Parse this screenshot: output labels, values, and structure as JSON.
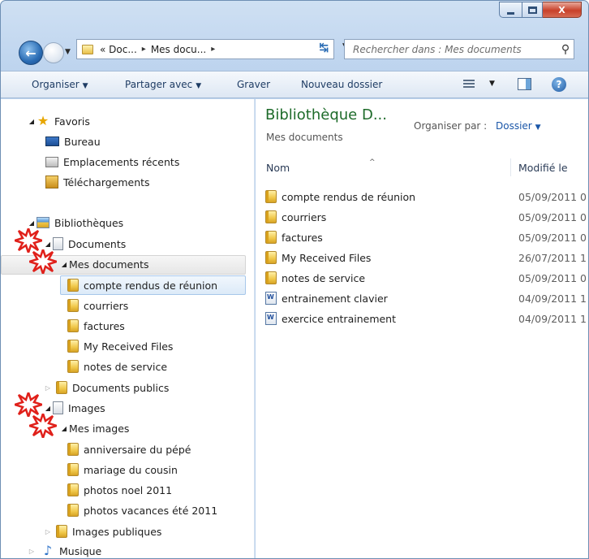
{
  "window": {
    "caption": {
      "minimize_icon": "minimize-icon",
      "maximize_icon": "maximize-icon",
      "close_icon": "close-icon",
      "close_glyph": "X"
    }
  },
  "navigation": {
    "back_glyph": "←",
    "address": {
      "crumb1": "«  Doc...",
      "crumb2": "Mes docu...",
      "separator": "▸"
    },
    "search": {
      "placeholder": "Rechercher dans : Mes documents"
    }
  },
  "commandbar": {
    "organize": "Organiser",
    "share": "Partager avec",
    "burn": "Graver",
    "new_folder": "Nouveau dossier",
    "help_glyph": "?"
  },
  "nav_tree": {
    "favorites": {
      "label": "Favoris",
      "items": [
        "Bureau",
        "Emplacements récents",
        "Téléchargements"
      ]
    },
    "libraries": {
      "label": "Bibliothèques",
      "documents": {
        "label": "Documents",
        "my_documents": {
          "label": "Mes documents",
          "children": [
            "compte rendus de réunion",
            "courriers",
            "factures",
            "My Received Files",
            "notes de service"
          ]
        },
        "public": "Documents publics"
      },
      "images": {
        "label": "Images",
        "my_images": {
          "label": "Mes images",
          "children": [
            "anniversaire du pépé",
            "mariage du cousin",
            "photos noel 2011",
            "photos vacances été 2011"
          ]
        },
        "public": "Images publiques"
      },
      "music": {
        "label": "Musique"
      }
    },
    "selected": "compte rendus de réunion"
  },
  "content": {
    "library_title": "Bibliothèque D...",
    "library_subtitle": "Mes documents",
    "arrange_label": "Organiser par :",
    "arrange_value": "Dossier",
    "columns": {
      "name": "Nom",
      "modified": "Modifié le"
    },
    "files": [
      {
        "name": "compte rendus de réunion",
        "date": "05/09/2011 0",
        "type": "folder"
      },
      {
        "name": "courriers",
        "date": "05/09/2011 0",
        "type": "folder"
      },
      {
        "name": "factures",
        "date": "05/09/2011 0",
        "type": "folder"
      },
      {
        "name": "My Received Files",
        "date": "26/07/2011 1",
        "type": "folder"
      },
      {
        "name": "notes de service",
        "date": "05/09/2011 0",
        "type": "folder"
      },
      {
        "name": "entrainement clavier",
        "date": "04/09/2011 1",
        "type": "document"
      },
      {
        "name": "exercice entrainement",
        "date": "04/09/2011 1",
        "type": "document"
      }
    ]
  },
  "colors": {
    "library_title": "#1e6b2a",
    "link": "#1a56a8",
    "selection": "#dceaf8",
    "annotation_star": "#e0201a"
  }
}
